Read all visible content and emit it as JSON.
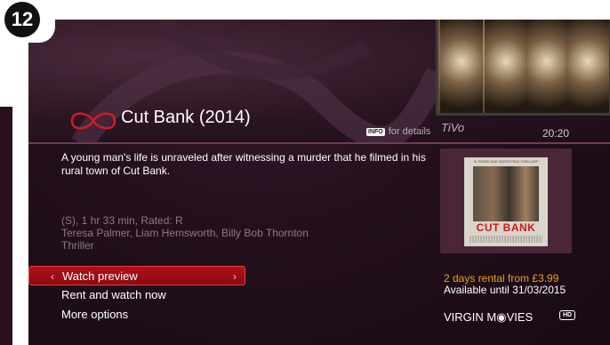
{
  "step": "12",
  "header": {
    "title": "Cut Bank (2014)",
    "info_badge": "INFO",
    "info_hint": "for details",
    "brand_mark": "TiVo",
    "time": "20:20"
  },
  "details": {
    "synopsis": "A young man's life is unraveled after witnessing a murder that he filmed in his rural town of Cut Bank.",
    "meta": "(S), 1 hr 33 min, Rated: R",
    "cast": "Teresa Palmer, Liam Hemsworth, Billy Bob Thornton",
    "genre": "Thriller"
  },
  "menu": {
    "items": [
      {
        "label": "Watch preview",
        "selected": true
      },
      {
        "label": "Rent and watch now",
        "selected": false
      },
      {
        "label": "More options",
        "selected": false
      }
    ]
  },
  "poster": {
    "tagline": "\"A TENSE AND SATISFYING THRILLER\"",
    "title": "CUT BANK"
  },
  "offer": {
    "rental": "2 days rental from £3.99",
    "availability": "Available until 31/03/2015",
    "channel": "VIRGIN M◉VIES",
    "hd": "HD"
  },
  "colors": {
    "accent_red": "#c8102e",
    "offer_orange": "#e8a21c"
  },
  "icons": [
    "virgin-logo-icon",
    "chevron-left-icon",
    "chevron-right-icon",
    "hd-icon"
  ]
}
